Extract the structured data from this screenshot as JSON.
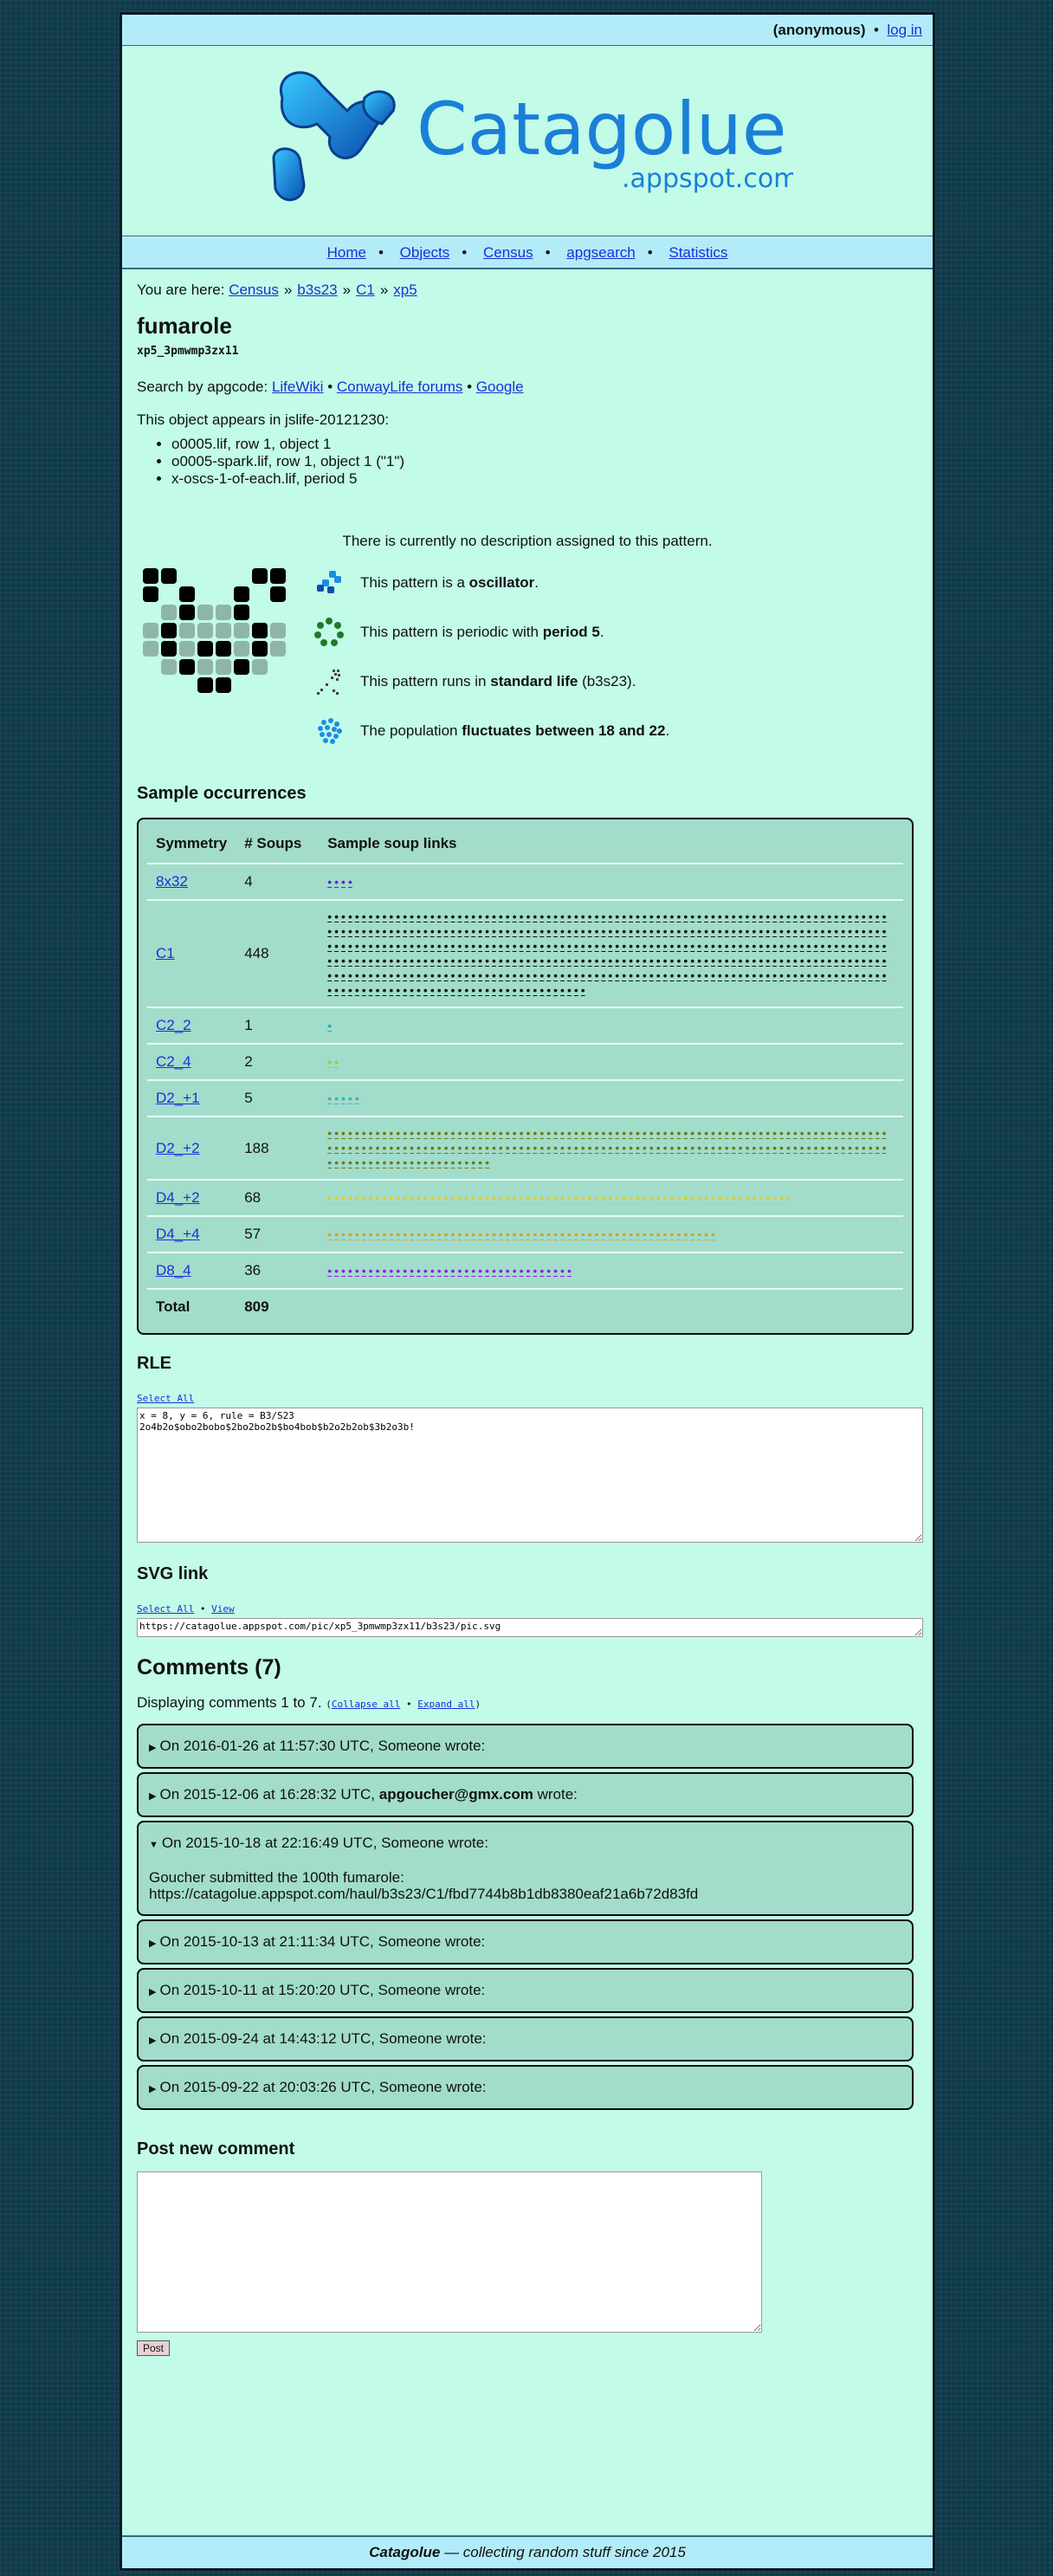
{
  "topbar": {
    "user": "(anonymous)",
    "login": "log in"
  },
  "logo": {
    "name": "Catagolue",
    "domain": ".appspot.com"
  },
  "nav": [
    "Home",
    "Objects",
    "Census",
    "apgsearch",
    "Statistics"
  ],
  "breadcrumb": {
    "prefix": "You are here:",
    "items": [
      "Census",
      "b3s23",
      "C1",
      "xp5"
    ]
  },
  "title": "fumarole",
  "apgcode": "xp5_3pmwmp3zx11",
  "search": {
    "label": "Search by apgcode:",
    "links": [
      "LifeWiki",
      "ConwayLife forums",
      "Google"
    ]
  },
  "appears": "This object appears in jslife-20121230:",
  "files": [
    "o0005.lif, row 1, object 1",
    "o0005-spark.lif, row 1, object 1 (\"1\")",
    "x-oscs-1-of-each.lif, period 5"
  ],
  "description": "There is currently no description assigned to this pattern.",
  "properties": [
    {
      "pre": "This pattern is a ",
      "bold": "oscillator",
      "post": ".",
      "icon": "oscillator-icon"
    },
    {
      "pre": "This pattern is periodic with ",
      "bold": "period 5",
      "post": ".",
      "icon": "period-icon"
    },
    {
      "pre": "This pattern runs in ",
      "bold": "standard life",
      "post": " (b3s23).",
      "icon": "rule-icon"
    },
    {
      "pre": "The population ",
      "bold": "fluctuates between 18 and 22",
      "post": ".",
      "icon": "population-icon"
    }
  ],
  "occurrences": {
    "title": "Sample occurrences",
    "headers": [
      "Symmetry",
      "# Soups",
      "Sample soup links"
    ],
    "rows": [
      {
        "sym": "8x32",
        "count": "4",
        "dots": 4,
        "color": "#6a1ee0"
      },
      {
        "sym": "C1",
        "count": "448",
        "dots": 448,
        "color": "#111111"
      },
      {
        "sym": "C2_2",
        "count": "1",
        "dots": 1,
        "color": "#1fa8c8"
      },
      {
        "sym": "C2_4",
        "count": "2",
        "dots": 2,
        "color": "#8fd81a"
      },
      {
        "sym": "D2_+1",
        "count": "5",
        "dots": 5,
        "color": "#2bb8c0"
      },
      {
        "sym": "D2_+2",
        "count": "188",
        "dots": 188,
        "color": "#6a7a16"
      },
      {
        "sym": "D4_+2",
        "count": "68",
        "dots": 68,
        "color": "#e8c81a"
      },
      {
        "sym": "D4_+4",
        "count": "57",
        "dots": 57,
        "color": "#d6a41a"
      },
      {
        "sym": "D8_4",
        "count": "36",
        "dots": 36,
        "color": "#8a1ee8"
      }
    ],
    "total_label": "Total",
    "total": "809"
  },
  "rle": {
    "title": "RLE",
    "select_all": "Select All",
    "text": "x = 8, y = 6, rule = B3/S23\n2o4b2o$obo2bobo$2bo2bo2b$bo4bob$b2o2b2ob$3b2o3b!"
  },
  "svg": {
    "title": "SVG link",
    "select_all": "Select All",
    "view": "View",
    "url": "https://catagolue.appspot.com/pic/xp5_3pmwmp3zx11/b3s23/pic.svg"
  },
  "comments": {
    "title": "Comments (7)",
    "displaying": "Displaying comments 1 to 7.",
    "collapse": "Collapse all",
    "expand": "Expand all",
    "items": [
      {
        "date": "On 2016-01-26 at 11:57:30 UTC, ",
        "author": "Someone",
        "suffix": " wrote:",
        "expanded": false,
        "bold": false
      },
      {
        "date": "On 2015-12-06 at 16:28:32 UTC, ",
        "author": "apgoucher@gmx.com",
        "suffix": " wrote:",
        "expanded": false,
        "bold": true
      },
      {
        "date": "On 2015-10-18 at 22:16:49 UTC, ",
        "author": "Someone",
        "suffix": " wrote:",
        "expanded": true,
        "bold": false,
        "body1": "Goucher submitted the 100th fumarole:",
        "body2": "https://catagolue.appspot.com/haul/b3s23/C1/fbd7744b8b1db8380eaf21a6b72d83fd"
      },
      {
        "date": "On 2015-10-13 at 21:11:34 UTC, ",
        "author": "Someone",
        "suffix": " wrote:",
        "expanded": false,
        "bold": false
      },
      {
        "date": "On 2015-10-11 at 15:20:20 UTC, ",
        "author": "Someone",
        "suffix": " wrote:",
        "expanded": false,
        "bold": false
      },
      {
        "date": "On 2015-09-24 at 14:43:12 UTC, ",
        "author": "Someone",
        "suffix": " wrote:",
        "expanded": false,
        "bold": false
      },
      {
        "date": "On 2015-09-22 at 20:03:26 UTC, ",
        "author": "Someone",
        "suffix": " wrote:",
        "expanded": false,
        "bold": false
      }
    ]
  },
  "post": {
    "title": "Post new comment",
    "button": "Post"
  },
  "footer": {
    "brand": "Catagolue",
    "tagline": " — collecting random stuff since 2015"
  }
}
